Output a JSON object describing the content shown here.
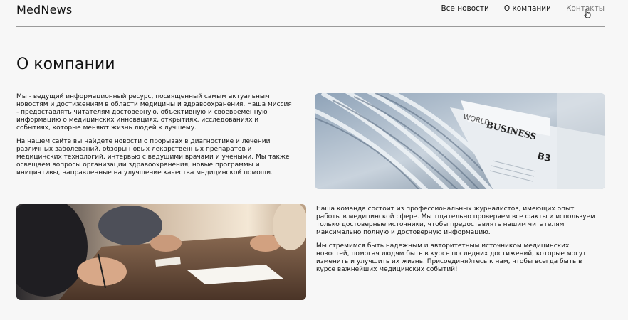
{
  "header": {
    "logo": "MedNews",
    "nav": [
      {
        "label": "Все новости"
      },
      {
        "label": "О компании"
      },
      {
        "label": "Контакты"
      }
    ]
  },
  "page": {
    "title": "О компании"
  },
  "section1": {
    "paragraphs": [
      "Мы - ведущий информационный ресурс, посвященный самым актуальным новостям и достижениям в области медицины и здравоохранения. Наша миссия - предоставлять читателям достоверную, объективную и своевременную информацию о медицинских инновациях, открытиях, исследованиях и событиях, которые меняют жизнь людей к лучшему.",
      "На нашем сайте вы найдете новости о прорывах в диагностике и лечении различных заболеваний, обзоры новых лекарственных препаратов и медицинских технологий, интервью с ведущими врачами и учеными. Мы также освещаем вопросы организации здравоохранения, новые программы и инициативы, направленные на улучшение качества медицинской помощи."
    ],
    "image_text": {
      "world": "WORLD",
      "business": "BUSINESS",
      "b3": "B3"
    }
  },
  "section2": {
    "paragraphs": [
      "Наша команда состоит из профессиональных журналистов, имеющих опыт работы в медицинской сфере. Мы тщательно проверяем все факты и используем только достоверные источники, чтобы предоставлять нашим читателям максимально полную и достоверную информацию.",
      "Мы стремимся быть надежным и авторитетным источником медицинских новостей, помогая людям быть в курсе последних достижений, которые могут изменить и улучшить их жизнь. Присоединяйтесь к нам, чтобы всегда быть в курсе важнейших медицинских событий!"
    ]
  }
}
